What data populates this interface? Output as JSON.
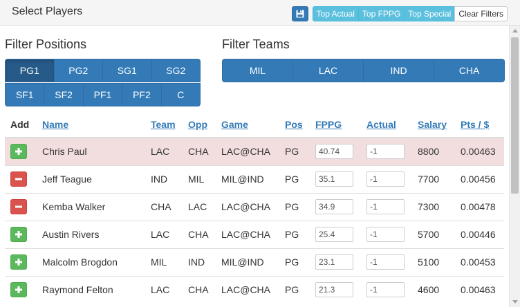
{
  "header": {
    "title": "Select Players",
    "toolbar": {
      "save_icon": "floppy-disk-icon",
      "buttons": [
        "Top Actual",
        "Top FPPG",
        "Top Special"
      ],
      "clear_label": "Clear Filters"
    }
  },
  "colors": {
    "primary": "#337ab7",
    "primary_active": "#265a88",
    "info": "#5bc0de",
    "success": "#5cb85c",
    "danger": "#d9534f",
    "row_highlight": "#f2dede"
  },
  "filters": {
    "positions_heading": "Filter Positions",
    "teams_heading": "Filter Teams",
    "positions_row1": [
      "PG1",
      "PG2",
      "SG1",
      "SG2"
    ],
    "positions_row2": [
      "SF1",
      "SF2",
      "PF1",
      "PF2",
      "C"
    ],
    "active_position": "PG1",
    "teams": [
      "MIL",
      "LAC",
      "IND",
      "CHA"
    ]
  },
  "table": {
    "columns": [
      "Add",
      "Name",
      "Team",
      "Opp",
      "Game",
      "Pos",
      "FPPG",
      "Actual",
      "Salary",
      "Pts / $"
    ],
    "rows": [
      {
        "action": "add",
        "name": "Chris Paul",
        "team": "LAC",
        "opp": "CHA",
        "game": "LAC@CHA",
        "pos": "PG",
        "fppg": "40.74",
        "actual": "-1",
        "salary": "8800",
        "pts_per_dollar": "0.00463",
        "highlight": true
      },
      {
        "action": "remove",
        "name": "Jeff Teague",
        "team": "IND",
        "opp": "MIL",
        "game": "MIL@IND",
        "pos": "PG",
        "fppg": "35.1",
        "actual": "-1",
        "salary": "7700",
        "pts_per_dollar": "0.00456",
        "highlight": false
      },
      {
        "action": "remove",
        "name": "Kemba Walker",
        "team": "CHA",
        "opp": "LAC",
        "game": "LAC@CHA",
        "pos": "PG",
        "fppg": "34.9",
        "actual": "-1",
        "salary": "7300",
        "pts_per_dollar": "0.00478",
        "highlight": false
      },
      {
        "action": "add",
        "name": "Austin Rivers",
        "team": "LAC",
        "opp": "CHA",
        "game": "LAC@CHA",
        "pos": "PG",
        "fppg": "25.4",
        "actual": "-1",
        "salary": "5700",
        "pts_per_dollar": "0.00446",
        "highlight": false
      },
      {
        "action": "add",
        "name": "Malcolm Brogdon",
        "team": "MIL",
        "opp": "IND",
        "game": "MIL@IND",
        "pos": "PG",
        "fppg": "23.1",
        "actual": "-1",
        "salary": "5100",
        "pts_per_dollar": "0.00453",
        "highlight": false
      },
      {
        "action": "add",
        "name": "Raymond Felton",
        "team": "LAC",
        "opp": "CHA",
        "game": "LAC@CHA",
        "pos": "PG",
        "fppg": "21.3",
        "actual": "-1",
        "salary": "4600",
        "pts_per_dollar": "0.00463",
        "highlight": false
      }
    ]
  }
}
